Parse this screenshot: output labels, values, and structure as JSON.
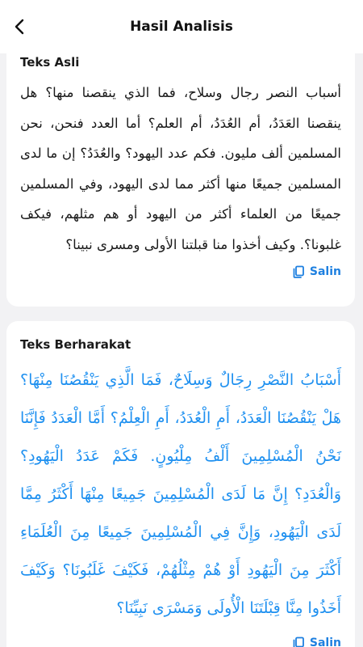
{
  "header": {
    "title": "Hasil Analisis",
    "back_icon": "chevron-left-icon"
  },
  "original": {
    "title": "Teks Asli",
    "text": "أسباب النصر رجال وسلاح، فما الذي ينقصنا منها؟ هل ينقصنا العَدَدُ، أم العُدَدُ، أم العلم؟ أما العدد فنحن، نحن المسلمين ألف مليون. فكم عدد اليهود؟ والعُدَدُ؟ إن ما لدى المسلمين جميعًا منها أكثر مما لدى اليهود، وفي المسلمين جميعًا من العلماء أكثر من اليهود أو هم مثلهم، فيكف غلبونا؟. وكيف أخذوا منا قبلتنا الأولى ومسرى نبينا؟",
    "copy_label": "Salin",
    "copy_icon": "copy-icon"
  },
  "harakat": {
    "title": "Teks Berharakat",
    "text": "أَسْبَابُ النَّصْرِ رِجَالٌ وَسِلَاحٌ، فَمَا الَّذِي يَنْقُصُنَا مِنْهَا؟ هَلْ يَنْقُصُنَا الْعَدَدُ، أَمِ الْعُدَدُ، أَمِ الْعِلْمُ؟ أَمَّا الْعَدَدُ فَإِنَّنَا نَحْنُ الْمُسْلِمِينَ أَلْفُ مِلْيُونٍ. فَكَمْ عَدَدُ الْيَهُودِ؟ وَالْعُدَدِ؟ إِنَّ مَا لَدَى الْمُسْلِمِينَ جَمِيعًا مِنْهَا أَكْثَرُ مِمَّا لَدَى الْيَهُودِ، وَإِنَّ فِي الْمُسْلِمِينَ جَمِيعًا مِنَ الْعُلَمَاءِ أَكْثَرَ مِنَ الْيَهُودِ أَوْ هُمْ مِثْلُهُمْ، فَكَيْفَ غَلَبُونَا؟ وَكَيْفَ أَخَذُوا مِنَّا قِبْلَتَنَا الْأُولَى وَمَسْرَى نَبِيِّنَا؟",
    "copy_label": "Salin",
    "copy_icon": "copy-icon"
  },
  "colors": {
    "accent": "#1e80e0",
    "vowel_text": "#1e90f0",
    "background": "#f2f2f4",
    "card": "#ffffff"
  }
}
